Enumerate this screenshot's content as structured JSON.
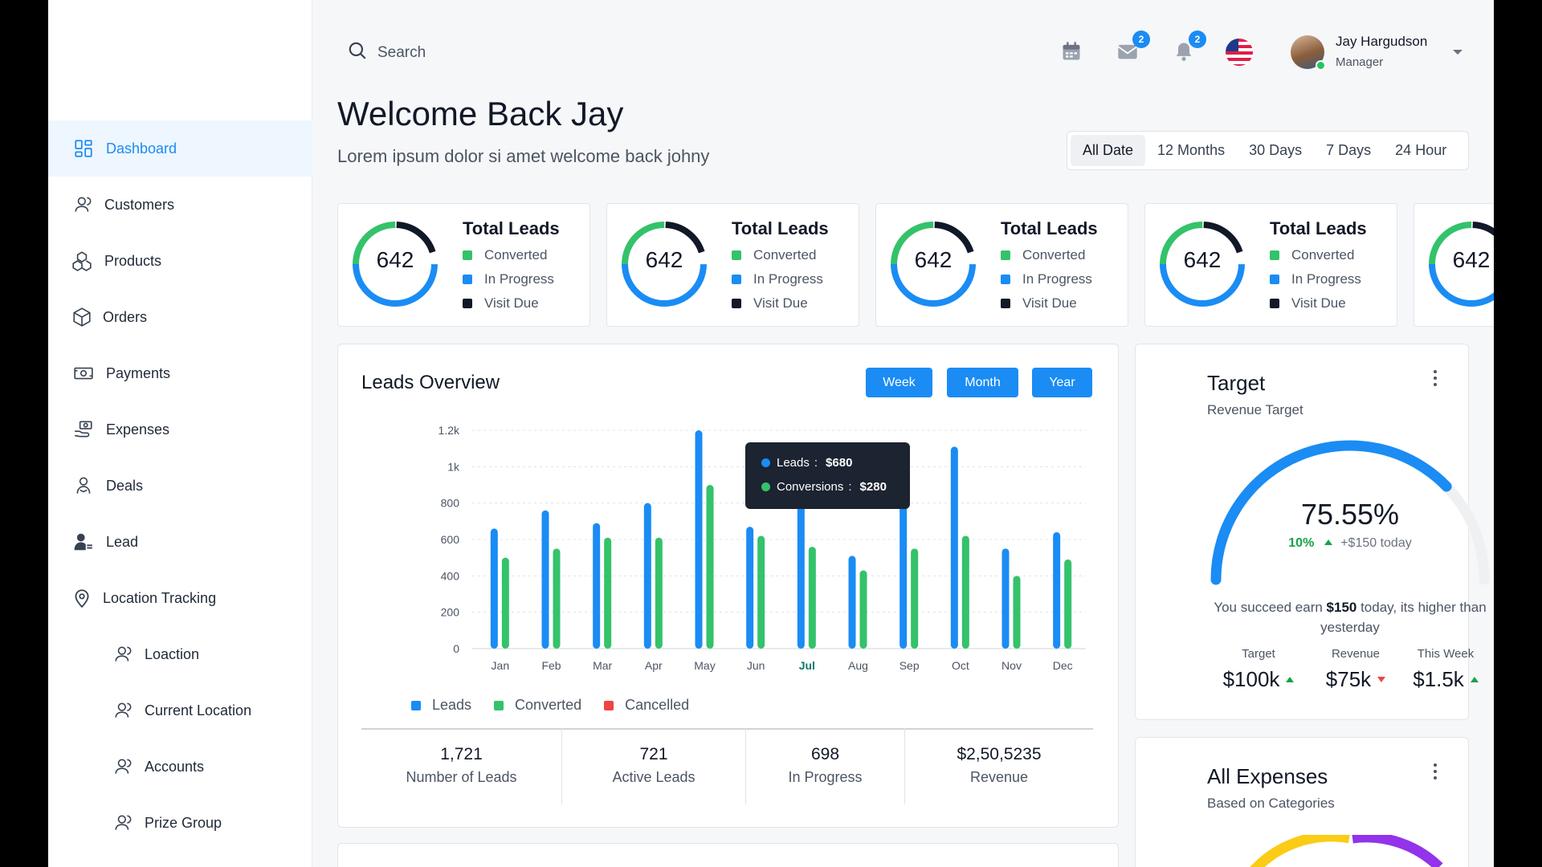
{
  "sidebar": {
    "items": [
      {
        "label": "Dashboard",
        "icon": "grid-icon"
      },
      {
        "label": "Customers",
        "icon": "users-icon"
      },
      {
        "label": "Products",
        "icon": "boxes-icon"
      },
      {
        "label": "Orders",
        "icon": "box-icon"
      },
      {
        "label": "Payments",
        "icon": "cash-icon"
      },
      {
        "label": "Expenses",
        "icon": "wallet-hand-icon"
      },
      {
        "label": "Deals",
        "icon": "handshake-icon"
      },
      {
        "label": "Lead",
        "icon": "user-lead-icon"
      },
      {
        "label": "Location Tracking",
        "icon": "map-pin-icon"
      },
      {
        "label": "Loaction",
        "icon": "users-icon"
      },
      {
        "label": "Current Location",
        "icon": "users-icon"
      },
      {
        "label": "Accounts",
        "icon": "users-icon"
      },
      {
        "label": "Prize Group",
        "icon": "users-icon"
      }
    ]
  },
  "header": {
    "search_label": "Search",
    "mail_badge": "2",
    "bell_badge": "2",
    "user_name": "Jay Hargudson",
    "user_role": "Manager"
  },
  "welcome": {
    "title": "Welcome Back Jay",
    "subtitle": "Lorem ipsum dolor si amet welcome back johny"
  },
  "date_filter": {
    "options": [
      "All Date",
      "12 Months",
      "30 Days",
      "7 Days",
      "24 Hour"
    ],
    "selected": "All Date"
  },
  "lead_cards": [
    {
      "value": "642",
      "title": "Total Leads",
      "rows": [
        "Converted",
        "In Progress",
        "Visit Due"
      ]
    },
    {
      "value": "642",
      "title": "Total Leads",
      "rows": [
        "Converted",
        "In Progress",
        "Visit Due"
      ]
    },
    {
      "value": "642",
      "title": "Total Leads",
      "rows": [
        "Converted",
        "In Progress",
        "Visit Due"
      ]
    },
    {
      "value": "642",
      "title": "Total Leads",
      "rows": [
        "Converted",
        "In Progress",
        "Visit Due"
      ]
    },
    {
      "value": "642"
    }
  ],
  "leads_overview": {
    "title": "Leads Overview",
    "buttons": [
      "Week",
      "Month",
      "Year"
    ],
    "tooltip": {
      "leads_label": "Leads",
      "leads_value": "$680",
      "conv_label": "Conversions",
      "conv_value": "$280"
    },
    "stats": [
      {
        "value": "1,721",
        "label": "Number of Leads"
      },
      {
        "value": "721",
        "label": "Active Leads"
      },
      {
        "value": "698",
        "label": "In Progress"
      },
      {
        "value": "$2,50,5235",
        "label": "Revenue"
      }
    ]
  },
  "chart_data": {
    "type": "bar",
    "categories": [
      "Jan",
      "Feb",
      "Mar",
      "Apr",
      "May",
      "Jun",
      "Jul",
      "Aug",
      "Sep",
      "Oct",
      "Nov",
      "Dec"
    ],
    "highlighted_category": "Jul",
    "series": [
      {
        "name": "Leads",
        "color": "#1a8cf4",
        "values": [
          660,
          760,
          690,
          800,
          1200,
          670,
          840,
          510,
          790,
          1110,
          550,
          640
        ]
      },
      {
        "name": "Converted",
        "color": "#34c26b",
        "values": [
          500,
          550,
          610,
          610,
          900,
          620,
          560,
          430,
          550,
          620,
          400,
          490
        ]
      },
      {
        "name": "Cancelled",
        "color": "#ef4444",
        "values": []
      }
    ],
    "y_ticks": [
      "0",
      "200",
      "400",
      "600",
      "800",
      "1k",
      "1.2k"
    ],
    "ylim": [
      0,
      1200
    ],
    "grid": true
  },
  "target": {
    "title": "Target",
    "subtitle": "Revenue Target",
    "percent": "75.55%",
    "percent_value": 75.55,
    "delta_pct": "10%",
    "delta_text": "+$150 today",
    "msg_pre": "You succeed earn ",
    "msg_bold": "$150",
    "msg_post": " today, its higher than yesterday",
    "cols": [
      {
        "label": "Target",
        "value": "$100k",
        "trend": "up"
      },
      {
        "label": "Revenue",
        "value": "$75k",
        "trend": "down"
      },
      {
        "label": "This Week",
        "value": "$1.5k",
        "trend": "up"
      }
    ]
  },
  "expenses": {
    "title": "All Expenses",
    "subtitle": "Based on Categories"
  }
}
